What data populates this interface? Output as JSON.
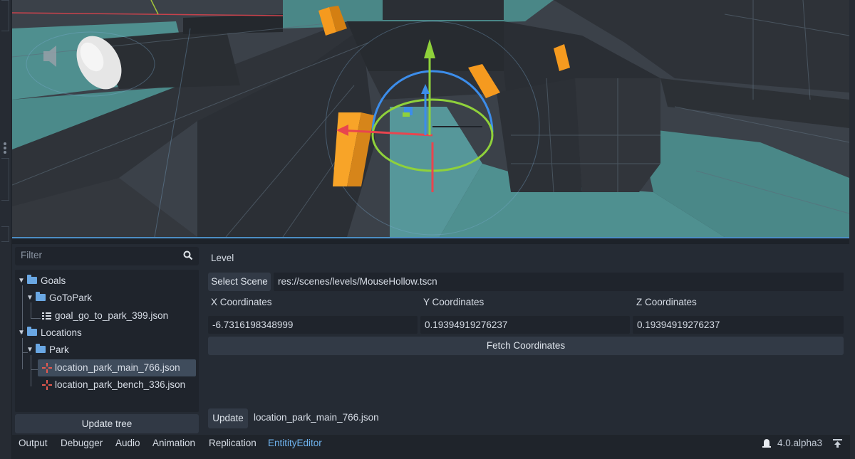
{
  "filter": {
    "placeholder": "Filter",
    "icon": "search-icon"
  },
  "tree": {
    "goals": "Goals",
    "goto_park": "GoToPark",
    "goal_file": "goal_go_to_park_399.json",
    "locations": "Locations",
    "park": "Park",
    "location_main": "location_park_main_766.json",
    "location_bench": "location_park_bench_336.json",
    "update_tree": "Update tree"
  },
  "form": {
    "level_label": "Level",
    "select_scene": "Select Scene",
    "scene_path": "res://scenes/levels/MouseHollow.tscn",
    "x_label": "X Coordinates",
    "y_label": "Y Coordinates",
    "z_label": "Z Coordinates",
    "x_value": "-6.7316198348999",
    "y_value": "0.19394919276237",
    "z_value": "0.19394919276237",
    "fetch": "Fetch Coordinates",
    "update": "Update",
    "current_file": "location_park_main_766.json"
  },
  "bottom_tabs": [
    "Output",
    "Debugger",
    "Audio",
    "Animation",
    "Replication",
    "EntitityEditor"
  ],
  "active_tab": "EntitityEditor",
  "version": "4.0.alpha3",
  "colors": {
    "accent": "#6fb3ee",
    "gizmo_x": "#e8454f",
    "gizmo_y": "#8fd13b",
    "gizmo_z": "#3c8dea",
    "orange": "#f59a1f",
    "floor": "#4f8f8f"
  }
}
